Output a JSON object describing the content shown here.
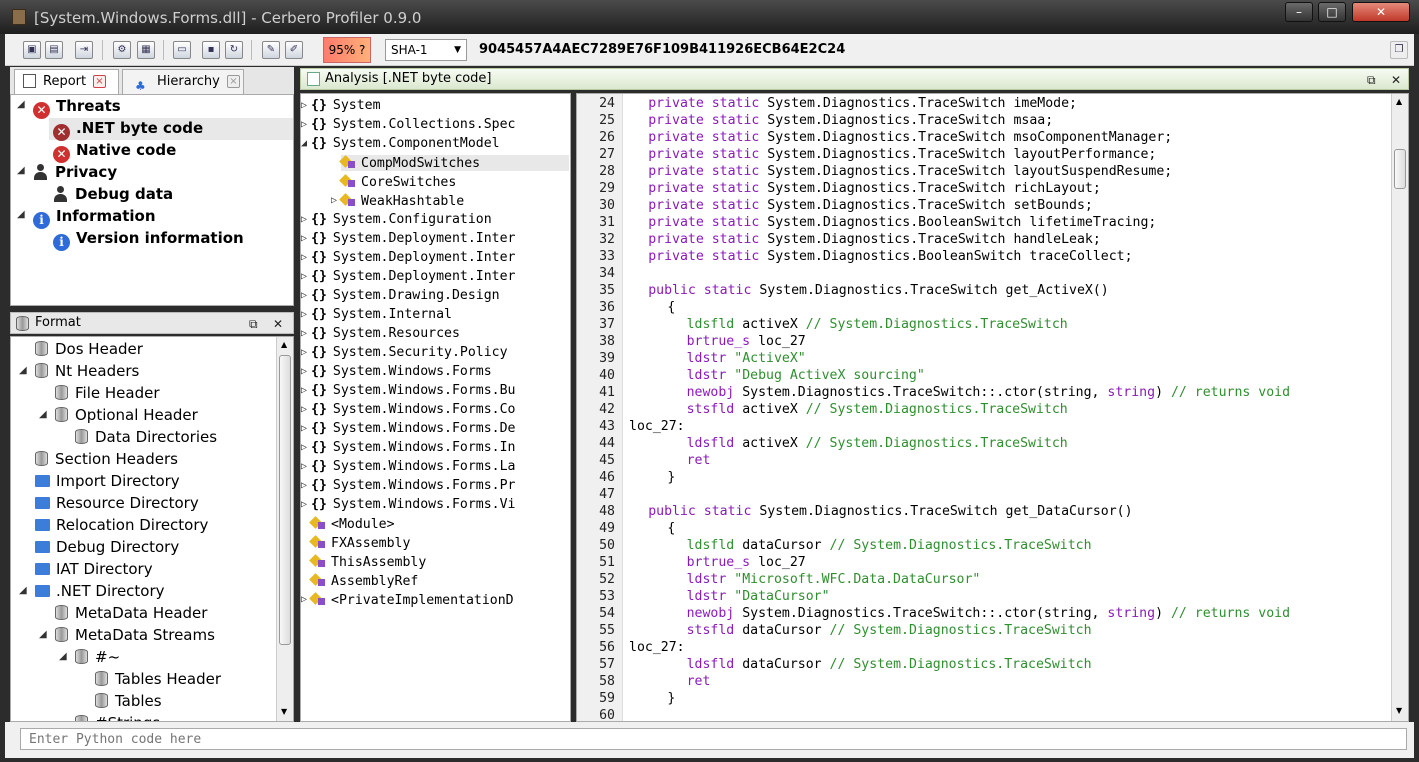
{
  "window": {
    "title": "[System.Windows.Forms.dll] - Cerbero Profiler 0.9.0"
  },
  "toolbar": {
    "percent": "95% ?",
    "hash_algo": "SHA-1",
    "hash_value": "9045457A4AEC7289E76F109B411926ECB64E2C24"
  },
  "tabs": [
    {
      "label": "Report"
    },
    {
      "label": "Hierarchy"
    }
  ],
  "report": {
    "threats": "Threats",
    "net_byte_code": ".NET byte code",
    "native_code": "Native code",
    "privacy": "Privacy",
    "debug_data": "Debug data",
    "information": "Information",
    "version_information": "Version information"
  },
  "format": {
    "header": "Format",
    "items": [
      "Dos Header",
      "Nt Headers",
      "File Header",
      "Optional Header",
      "Data Directories",
      "Section Headers",
      "Import Directory",
      "Resource Directory",
      "Relocation Directory",
      "Debug Directory",
      "IAT Directory",
      ".NET Directory",
      "MetaData Header",
      "MetaData Streams",
      "#~",
      "Tables Header",
      "Tables",
      "#Strings"
    ]
  },
  "analysis": {
    "header": "Analysis [.NET byte code]",
    "namespaces": [
      "System",
      "System.Collections.Spec",
      "System.ComponentModel",
      "CompModSwitches",
      "CoreSwitches",
      "WeakHashtable",
      "System.Configuration",
      "System.Deployment.Inter",
      "System.Deployment.Inter",
      "System.Deployment.Inter",
      "System.Drawing.Design",
      "System.Internal",
      "System.Resources",
      "System.Security.Policy",
      "System.Windows.Forms",
      "System.Windows.Forms.Bu",
      "System.Windows.Forms.Co",
      "System.Windows.Forms.De",
      "System.Windows.Forms.In",
      "System.Windows.Forms.La",
      "System.Windows.Forms.Pr",
      "System.Windows.Forms.Vi",
      "<Module>",
      "FXAssembly",
      "ThisAssembly",
      "AssemblyRef",
      "<PrivateImplementationD"
    ]
  },
  "code": {
    "line_numbers": [
      "24",
      "25",
      "26",
      "27",
      "28",
      "29",
      "30",
      "31",
      "32",
      "33",
      "34",
      "35",
      "36",
      "37",
      "38",
      "39",
      "40",
      "41",
      "42",
      "43",
      "44",
      "45",
      "46",
      "47",
      "48",
      "49",
      "50",
      "51",
      "52",
      "53",
      "54",
      "55",
      "56",
      "57",
      "58",
      "59",
      "60"
    ],
    "l24": "imeMode;",
    "l25": "msaa;",
    "l26": "msoComponentManager;",
    "l27": "layoutPerformance;",
    "l28": "layoutSuspendResume;",
    "l29": "richLayout;",
    "l30": "setBounds;",
    "l31": "lifetimeTracing;",
    "l32": "handleLeak;",
    "l33": "traceCollect;",
    "kw_private_static": "private static",
    "kw_public_static": "public static",
    "type_traceswitch": "System.Diagnostics.TraceSwitch",
    "type_booleanswitch": "System.Diagnostics.BooleanSwitch",
    "m1": "get_ActiveX()",
    "m2": "get_DataCursor()",
    "ob": "{",
    "cb": "}",
    "op_ldsfld": "ldsfld",
    "op_brtrue": "brtrue_s",
    "op_ldstr": "ldstr",
    "op_newobj": "newobj",
    "op_stsfld": "stsfld",
    "op_ret": "ret",
    "fld_activex": "activeX",
    "fld_datacursor": "dataCursor",
    "cmt_traceswitch": "// System.Diagnostics.TraceSwitch",
    "loc27": "loc_27",
    "loc27_label": "loc_27:",
    "str_activex": "\"ActiveX\"",
    "str_debugactivex": "\"Debug ActiveX sourcing\"",
    "str_wfc": "\"Microsoft.WFC.Data.DataCursor\"",
    "str_datacursor": "\"DataCursor\"",
    "ctor_a": "System.Diagnostics.TraceSwitch::.ctor(string,",
    "ctor_b": "string",
    ")_close": "",
    "ctor_close": ")",
    "cmt_returns": "// returns void"
  },
  "python": {
    "placeholder": "Enter Python code here"
  }
}
